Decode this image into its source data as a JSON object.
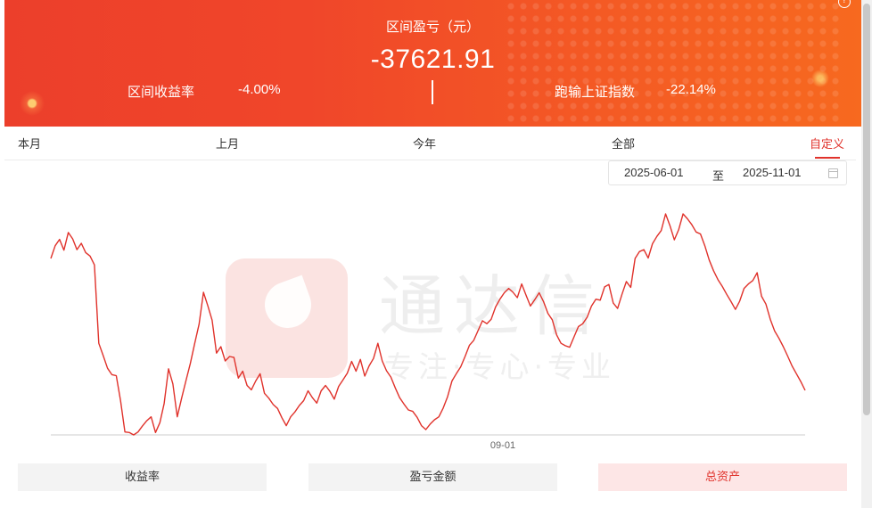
{
  "header": {
    "title": "区间盈亏（元）",
    "value": "-37621.91",
    "left_stat": {
      "label": "区间收益率",
      "value": "-4.00%"
    },
    "right_stat": {
      "label": "跑输上证指数",
      "value": "-22.14%"
    },
    "help_glyph": "?"
  },
  "tabs": [
    "本月",
    "上月",
    "今年",
    "全部",
    "自定义"
  ],
  "active_tab": "自定义",
  "date_range": {
    "start": "2025-06-01",
    "separator": "至",
    "end": "2025-11-01"
  },
  "watermark": {
    "name": "通达信",
    "slogan": "专注·专心·专业"
  },
  "chart_data": {
    "type": "line",
    "x_tick_label": "09-01",
    "line_color": "#e0322b",
    "series": [
      {
        "values": [
          0.39,
          0.65,
          0.78,
          0.56,
          0.92,
          0.79,
          0.57,
          0.7,
          0.51,
          0.44,
          0.26,
          -1.34,
          -1.59,
          -1.85,
          -1.98,
          -2.0,
          -2.51,
          -3.15,
          -3.16,
          -3.21,
          -3.15,
          -3.03,
          -2.92,
          -2.84,
          -3.16,
          -2.96,
          -2.57,
          -1.86,
          -2.17,
          -2.84,
          -2.46,
          -2.1,
          -1.75,
          -1.34,
          -0.95,
          -0.3,
          -0.57,
          -0.87,
          -1.54,
          -1.41,
          -1.7,
          -1.61,
          -1.63,
          -2.05,
          -1.91,
          -2.2,
          -2.29,
          -2.11,
          -1.96,
          -2.36,
          -2.46,
          -2.59,
          -2.67,
          -2.86,
          -3.02,
          -2.84,
          -2.74,
          -2.61,
          -2.51,
          -2.31,
          -2.45,
          -2.56,
          -2.31,
          -2.2,
          -2.32,
          -2.48,
          -2.22,
          -2.09,
          -1.95,
          -1.71,
          -1.91,
          -1.67,
          -2.01,
          -1.8,
          -1.65,
          -1.34,
          -1.7,
          -1.9,
          -2.03,
          -2.25,
          -2.45,
          -2.58,
          -2.7,
          -2.73,
          -2.85,
          -3.02,
          -3.1,
          -2.99,
          -2.9,
          -2.84,
          -2.66,
          -2.43,
          -2.11,
          -1.96,
          -1.82,
          -1.61,
          -1.38,
          -1.28,
          -1.08,
          -0.88,
          -0.94,
          -0.85,
          -0.6,
          -0.44,
          -0.31,
          -0.22,
          -0.3,
          -0.41,
          -0.13,
          -0.36,
          -0.58,
          -0.45,
          -0.31,
          -0.49,
          -0.73,
          -0.86,
          -1.17,
          -1.34,
          -1.39,
          -1.42,
          -1.21,
          -1.0,
          -0.94,
          -0.81,
          -0.58,
          -0.44,
          -0.46,
          -0.19,
          -0.14,
          -0.52,
          -0.63,
          -0.34,
          -0.08,
          -0.2,
          0.39,
          0.53,
          0.57,
          0.4,
          0.69,
          0.84,
          0.96,
          1.3,
          1.06,
          0.77,
          0.98,
          1.3,
          1.2,
          1.08,
          0.93,
          0.89,
          0.65,
          0.36,
          0.14,
          -0.04,
          -0.18,
          -0.34,
          -0.49,
          -0.65,
          -0.48,
          -0.22,
          -0.13,
          -0.06,
          0.1,
          -0.38,
          -0.54,
          -0.85,
          -1.09,
          -1.24,
          -1.41,
          -1.6,
          -1.8,
          -1.96,
          -2.12,
          -2.3
        ]
      }
    ]
  },
  "buttons": [
    "收益率",
    "盈亏金额",
    "总资产"
  ],
  "active_button": "总资产"
}
